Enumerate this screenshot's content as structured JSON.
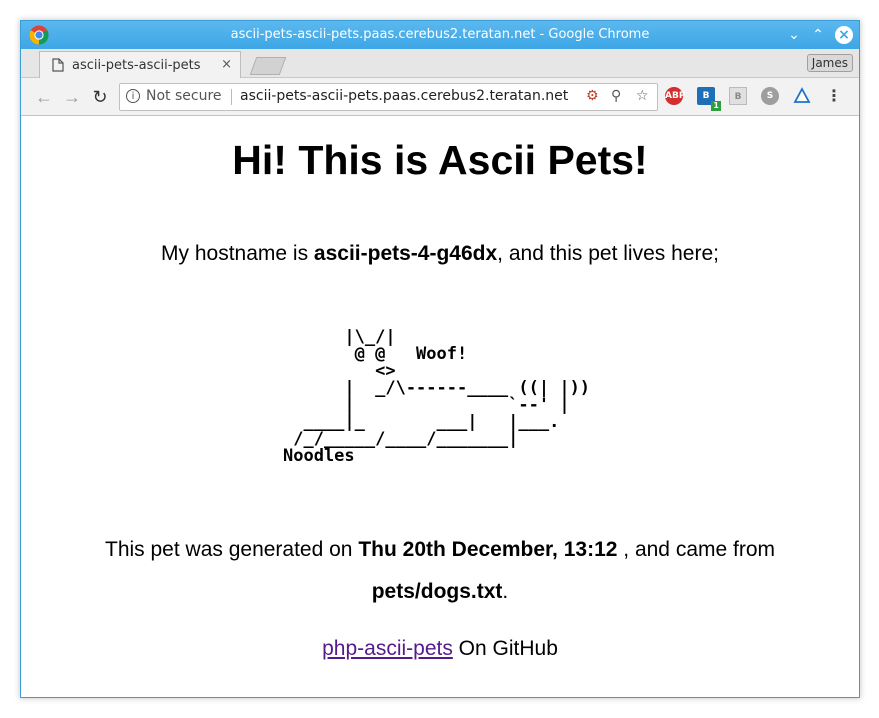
{
  "window": {
    "title": "ascii-pets-ascii-pets.paas.cerebus2.teratan.net - Google Chrome"
  },
  "tab": {
    "label": "ascii-pets-ascii-pets",
    "close": "×"
  },
  "profile": {
    "name": "James"
  },
  "omnibox": {
    "security": "Not secure",
    "url": "ascii-pets-ascii-pets.paas.cerebus2.teratan.net"
  },
  "extensions": {
    "abp_label": "ABP",
    "badge_count": "1"
  },
  "page": {
    "heading": "Hi! This is Ascii Pets!",
    "host_prefix": "My hostname is ",
    "hostname": "ascii-pets-4-g46dx",
    "host_suffix": ", and this pet lives here;",
    "ascii_art": "      |\\_/|\n       @ @   Woof!\n         <>\n      |  _/\\------____ ((| |))\n      |               `--' |\n  ____|_       ___|   |___.\n /_/_____/____/_______|\nNoodles",
    "gen_prefix": "This pet was generated on ",
    "generated_on": "Thu 20th December, 13:12",
    "gen_middle": " , and came from ",
    "source_file": "pets/dogs.txt",
    "source_suffix": ".",
    "link_text": "php-ascii-pets",
    "link_suffix": " On GitHub"
  },
  "colors": {
    "titlebar": "#3da6e6",
    "link": "#551a8b"
  }
}
